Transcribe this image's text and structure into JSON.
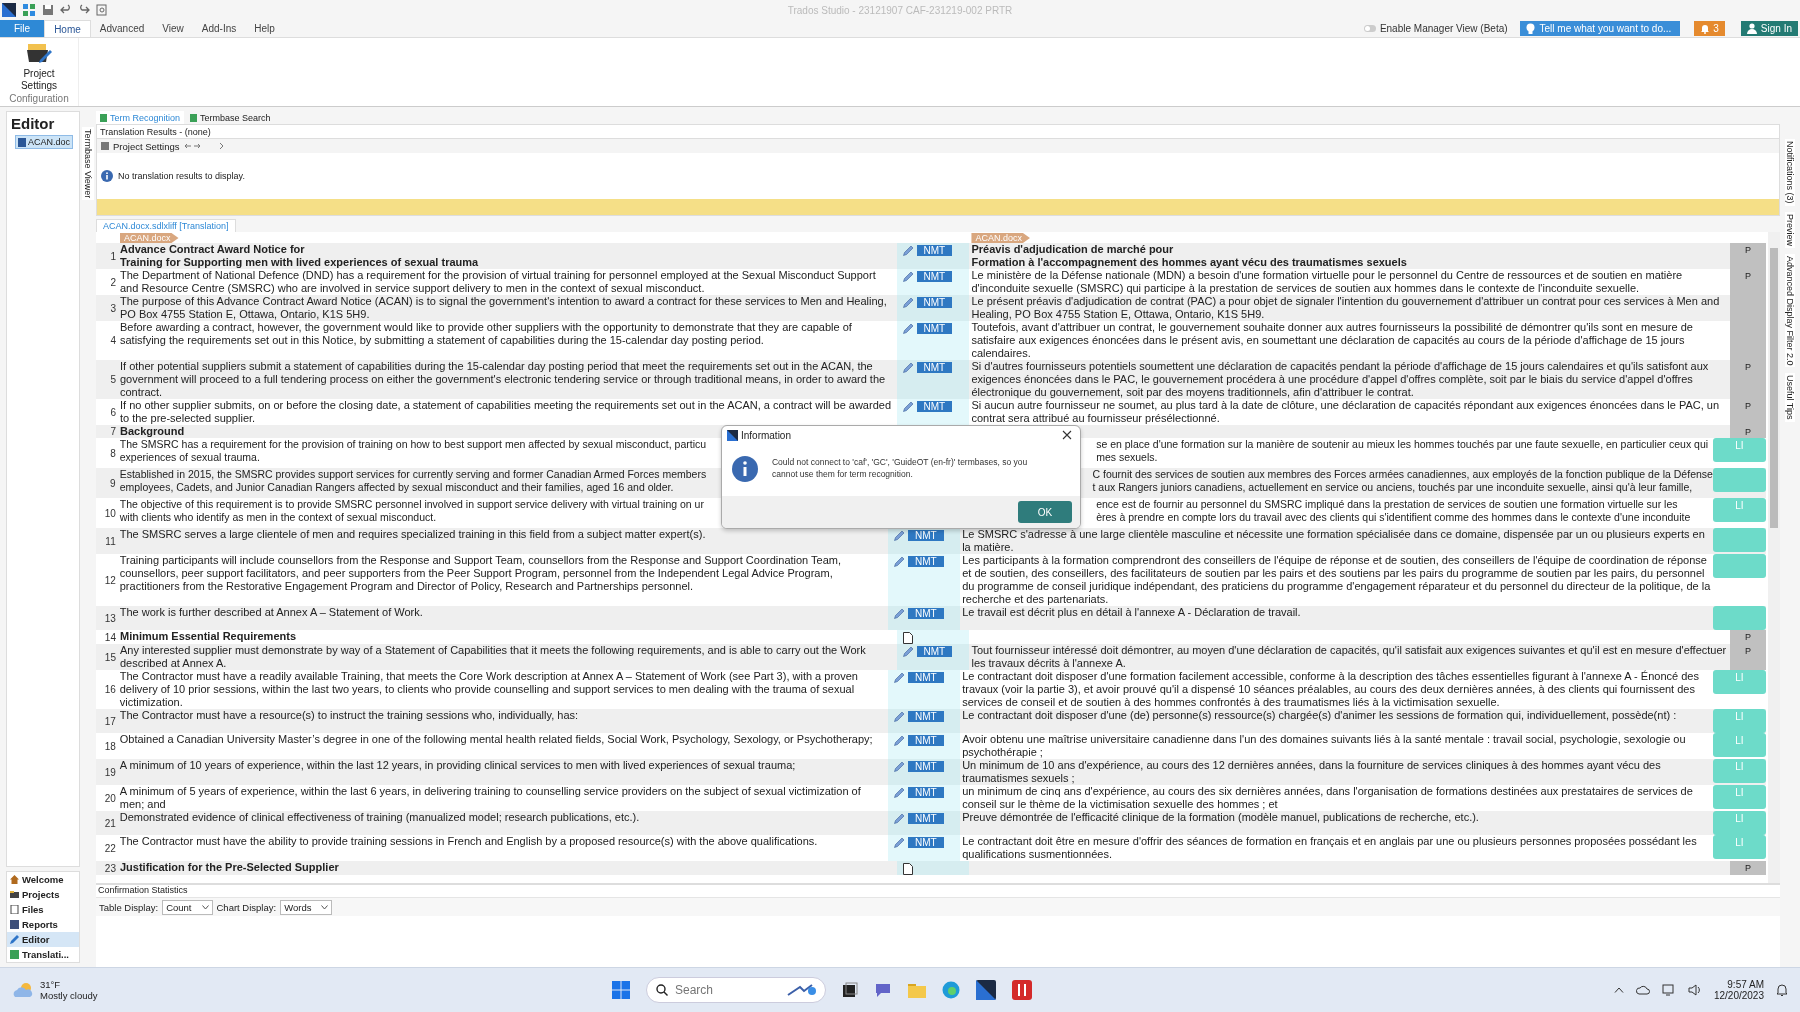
{
  "window": {
    "title": "Trados Studio - 23121907 CAF-231219-002 PRTR"
  },
  "ribbon_tabs": [
    {
      "label": "File",
      "kind": "file",
      "selected": false
    },
    {
      "label": "Home",
      "kind": "tab",
      "selected": true
    },
    {
      "label": "Advanced",
      "kind": "tab",
      "selected": false
    },
    {
      "label": "View",
      "kind": "tab",
      "selected": false
    },
    {
      "label": "Add-Ins",
      "kind": "tab",
      "selected": false
    },
    {
      "label": "Help",
      "kind": "tab",
      "selected": false
    }
  ],
  "manager_view": {
    "label": "Enable Manager View (Beta)",
    "on": false
  },
  "tell_me": "Tell me what you want to do...",
  "notifications_count": "3",
  "sign_in": "Sign In",
  "ribbon_group": {
    "button": "Project Settings",
    "label": "Configuration"
  },
  "navigation": {
    "title": "Editor",
    "files": [
      {
        "name": "ACAN.doc",
        "selected": true
      }
    ],
    "views": [
      {
        "label": "Welcome",
        "selected": false
      },
      {
        "label": "Projects",
        "selected": false
      },
      {
        "label": "Files",
        "selected": false
      },
      {
        "label": "Reports",
        "selected": false
      },
      {
        "label": "Editor",
        "selected": true
      },
      {
        "label": "Translati...",
        "selected": false
      }
    ]
  },
  "side_tab_left": "Termbase Viewer",
  "term_panel": {
    "tabs": [
      {
        "label": "Term Recognition",
        "selected": true
      },
      {
        "label": "Termbase Search",
        "selected": false
      }
    ],
    "title": "Translation Results - (none)",
    "toolbar_label": "Project Settings",
    "message": "No translation results to display."
  },
  "editor": {
    "document_tab": "ACAN.docx.sdlxliff [Translation]",
    "source_file_tag": "ACAN.docx",
    "target_file_tag": "ACAN.docx",
    "rows": [
      {
        "number": "1",
        "heading": true,
        "kind": "nmt",
        "origin": "NMT",
        "status": "P",
        "confirmed": false,
        "source": "Advance Contract Award Notice for\nTraining for Supporting men with lived experiences of sexual trauma",
        "target": "Préavis d'adjudication de marché pour\nFormation à l'accompagnement des hommes ayant vécu des traumatismes sexuels"
      },
      {
        "number": "2",
        "heading": false,
        "kind": "nmt",
        "origin": "NMT",
        "status": "P",
        "confirmed": false,
        "source": "The Department of National Defence (DND) has a requirement for the provision of virtual training for personnel employed at the Sexual Misconduct Support and Resource Centre (SMSRC) who are involved in service support delivery to men in the context of sexual misconduct.",
        "target": "Le ministère de la Défense nationale (MDN) a besoin d'une formation virtuelle pour le personnel du Centre de ressources et de soutien en matière d'inconduite sexuelle (SMSRC) qui participe à la prestation de services de soutien aux hommes dans le contexte de l'inconduite sexuelle."
      },
      {
        "number": "3",
        "heading": false,
        "kind": "nmt",
        "origin": "NMT",
        "confirmed": false,
        "source": "The purpose of this Advance Contract Award Notice (ACAN) is to signal the government's intention to award a contract for these services to Men and Healing, PO Box 4755 Station E, Ottawa, Ontario, K1S 5H9.",
        "target": "Le présent préavis d'adjudication de contrat (PAC) a pour objet de signaler l'intention du gouvernement d'attribuer un contrat pour ces services à Men and Healing, PO Box 4755 Station E, Ottawa, Ontario, K1S 5H9."
      },
      {
        "number": "4",
        "heading": false,
        "kind": "nmt",
        "origin": "NMT",
        "confirmed": false,
        "source": "Before awarding a contract, however, the government would like to provide other suppliers with the opportunity to demonstrate that they are capable of satisfying the requirements set out in this Notice, by submitting a statement of capabilities during the 15-calendar day posting period.",
        "target": "Toutefois, avant d'attribuer un contrat, le gouvernement souhaite donner aux autres fournisseurs la possibilité de démontrer qu'ils sont en mesure de satisfaire aux exigences énoncées dans le présent avis, en soumettant une déclaration de capacités au cours de la période d'affichage de 15 jours calendaires."
      },
      {
        "number": "5",
        "heading": false,
        "kind": "nmt",
        "origin": "NMT",
        "status": "P",
        "confirmed": false,
        "source": "If other potential suppliers submit a statement of capabilities during the 15-calendar day posting period that meet the requirements set out in the ACAN, the government will proceed to a full tendering process on either the government's electronic tendering service or through traditional means, in order to award the contract.",
        "target": "Si d'autres fournisseurs potentiels soumettent une déclaration de capacités pendant la période d'affichage de 15 jours calendaires et qu'ils satisfont aux exigences énoncées dans le PAC, le gouvernement procédera à une procédure d'appel d'offres complète, soit par le biais du service d'appel d'offres électronique du gouvernement, soit par des moyens traditionnels, afin d'attribuer le contrat."
      },
      {
        "number": "6",
        "heading": false,
        "kind": "nmt",
        "origin": "NMT",
        "status": "P",
        "confirmed": false,
        "source": "If no other supplier submits, on or before the closing date, a statement of capabilities meeting the requirements set out in the ACAN, a contract will be awarded to the pre-selected supplier.",
        "target": "Si aucun autre fournisseur ne soumet, au plus tard à la date de clôture, une déclaration de capacités répondant aux exigences énoncées dans le PAC, un contrat sera attribué au fournisseur présélectionné."
      },
      {
        "number": "7",
        "heading": true,
        "kind": "covered",
        "status": "P",
        "confirmed": false,
        "source": "Background"
      },
      {
        "number": "8",
        "heading": false,
        "kind": "covered",
        "status": "LI",
        "confirmed": true,
        "source": [
          "The SMSRC has a requirement for the provision of training on how to best support men affected by sexual misconduct, particu",
          "experiences of sexual trauma."
        ],
        "target": [
          "se en place d'une formation sur la manière de soutenir au mieux les hommes touchés par une faute sexuelle, en particulier ceux qui",
          "mes sexuels."
        ]
      },
      {
        "number": "9",
        "heading": false,
        "kind": "covered",
        "confirmed": true,
        "source": [
          "Established in 2015, the SMSRC provides support services for currently serving and former Canadian Armed Forces members",
          "employees, Cadets, and Junior Canadian Rangers affected by sexual misconduct and their families, aged 16 and older."
        ],
        "target": [
          "C fournit des services de soutien aux membres des Forces armées canadiennes, aux employés de la fonction publique de la Défense",
          "t aux Rangers juniors canadiens, actuellement en service ou anciens, touchés par une inconduite sexuelle, ainsi qu'à leur famille,"
        ]
      },
      {
        "number": "10",
        "heading": false,
        "kind": "covered",
        "status": "LI",
        "confirmed": true,
        "source": [
          "The objective of this requirement is to provide SMSRC personnel involved in support service delivery with virtual training on ur",
          "with clients who identify as men in the context of sexual misconduct."
        ],
        "target": [
          "ence est de fournir au personnel du SMSRC impliqué dans la prestation de services de soutien une formation virtuelle sur les",
          "ères à prendre en compte lors du travail avec des clients qui s'identifient comme des hommes dans le contexte d'une inconduite"
        ]
      },
      {
        "number": "11",
        "heading": false,
        "kind": "nmt",
        "origin": "NMT",
        "confirmed": true,
        "source": "The SMSRC serves a large clientele of men and requires specialized training in this field from a subject matter expert(s).",
        "target": "Le SMSRC s'adresse à une large clientèle masculine et nécessite une formation spécialisée dans ce domaine, dispensée par un ou plusieurs experts en la matière."
      },
      {
        "number": "12",
        "heading": false,
        "kind": "nmt",
        "origin": "NMT",
        "confirmed": true,
        "source": "Training participants will include counsellors from the Response and Support Team, counsellors from the Response and Support Coordination Team, counsellors, peer support facilitators, and peer supporters from the Peer Support Program, personnel from the Independent Legal Advice Program, practitioners from the Restorative Engagement Program and Director of Policy, Research and Partnerships personnel.",
        "target": "Les participants à la formation comprendront des conseillers de l'équipe de réponse et de soutien, des conseillers de l'équipe de coordination de réponse et de soutien, des conseillers, des facilitateurs de soutien par les pairs et des soutiens par les pairs du programme de soutien par les pairs, du personnel du programme de conseil juridique indépendant, des praticiens du programme d'engagement réparateur et du personnel du directeur de la politique, de la recherche et des partenariats."
      },
      {
        "number": "13",
        "heading": false,
        "kind": "nmt",
        "origin": "NMT",
        "confirmed": true,
        "source": "The work is further described at Annex A – Statement of Work.",
        "target": "Le travail est décrit plus en détail à l'annexe A - Déclaration de travail."
      },
      {
        "number": "14",
        "heading": true,
        "kind": "blank",
        "status": "P",
        "confirmed": false,
        "source": "Minimum Essential Requirements"
      },
      {
        "number": "15",
        "heading": false,
        "kind": "nmt",
        "origin": "NMT",
        "status": "P",
        "confirmed": false,
        "source": "Any interested supplier must demonstrate by way of a Statement of Capabilities that it meets the following requirements, and is able to carry out the Work described at Annex A.",
        "target": "Tout fournisseur intéressé doit démontrer, au moyen d'une déclaration de capacités, qu'il satisfait aux exigences suivantes et qu'il est en mesure d'effectuer les travaux décrits à l'annexe A."
      },
      {
        "number": "16",
        "heading": false,
        "kind": "nmt",
        "origin": "NMT",
        "status": "LI",
        "confirmed": true,
        "source": "The Contractor must have a readily available Training, that meets the Core Work description at Annex A – Statement of Work (see Part 3), with a proven delivery of 10 prior sessions, within the last two years, to clients who provide counselling and support services to men dealing with the trauma of sexual victimization.",
        "target": "Le contractant doit disposer d'une formation facilement accessible, conforme à la description des tâches essentielles figurant à l'annexe A - Énoncé des travaux (voir la partie 3), et avoir prouvé qu'il a dispensé 10 séances préalables, au cours des deux dernières années, à des clients qui fournissent des services de conseil et de soutien à des hommes confrontés à des traumatismes liés à la victimisation sexuelle."
      },
      {
        "number": "17",
        "heading": false,
        "kind": "nmt",
        "origin": "NMT",
        "status": "LI",
        "confirmed": true,
        "source": "The Contractor must have a resource(s) to instruct the training sessions who, individually, has:",
        "target": "Le contractant doit disposer d'une (de) personne(s) ressource(s) chargée(s) d'animer les sessions de formation qui, individuellement, possède(nt) :"
      },
      {
        "number": "18",
        "heading": false,
        "kind": "nmt",
        "origin": "NMT",
        "status": "LI",
        "confirmed": true,
        "source": "Obtained a Canadian University Master’s degree in one of the following mental health related fields, Social Work, Psychology, Sexology, or Psychotherapy;",
        "target": "Avoir obtenu une maîtrise universitaire canadienne dans l'un des domaines suivants liés à la santé mentale : travail social, psychologie, sexologie ou psychothérapie ;"
      },
      {
        "number": "19",
        "heading": false,
        "kind": "nmt",
        "origin": "NMT",
        "status": "LI",
        "confirmed": true,
        "source": "A minimum of 10 years of experience, within the last 12 years, in providing clinical services to men with lived experiences of sexual trauma;",
        "target": "Un minimum de 10 ans d'expérience, au cours des 12 dernières années, dans la fourniture de services cliniques à des hommes ayant vécu des traumatismes sexuels ;"
      },
      {
        "number": "20",
        "heading": false,
        "kind": "nmt",
        "origin": "NMT",
        "status": "LI",
        "confirmed": true,
        "source": "A minimum of 5 years of experience, within the last 6 years, in delivering training to counselling service providers on the subject of sexual victimization of men; and",
        "target": "un minimum de cinq ans d'expérience, au cours des six dernières années, dans l'organisation de formations destinées aux prestataires de services de conseil sur le thème de la victimisation sexuelle des hommes ; et"
      },
      {
        "number": "21",
        "heading": false,
        "kind": "nmt",
        "origin": "NMT",
        "status": "LI",
        "confirmed": true,
        "source": "Demonstrated evidence of clinical effectiveness of training (manualized model; research publications, etc.).",
        "target": "Preuve démontrée de l'efficacité clinique de la formation (modèle manuel, publications de recherche, etc.)."
      },
      {
        "number": "22",
        "heading": false,
        "kind": "nmt",
        "origin": "NMT",
        "status": "LI",
        "confirmed": true,
        "source": "The Contractor must have the ability to provide training sessions in French and English by a proposed resource(s) with the above qualifications.",
        "target": "Le contractant doit être en mesure d'offrir des séances de formation en français et en anglais par une ou plusieurs personnes proposées possédant les qualifications susmentionnées."
      },
      {
        "number": "23",
        "heading": true,
        "kind": "blank",
        "status": "P",
        "confirmed": false,
        "source": "Justification for the Pre-Selected Supplier"
      }
    ]
  },
  "right_tabs": [
    "Notifications (3)",
    "Preview",
    "Advanced Display Filter 2.0",
    "Useful Tips"
  ],
  "statistics": {
    "title": "Confirmation Statistics",
    "table_display_label": "Table Display:",
    "table_display": "Count",
    "chart_display_label": "Chart Display:",
    "chart_display": "Words"
  },
  "dialog": {
    "title": "Information",
    "message": "Could not connect to 'caf', 'GC', 'GuideOT (en-fr)' termbases, so you cannot use them for term recognition.",
    "button": "OK"
  },
  "taskbar": {
    "weather_temp": "31°F",
    "weather_text": "Mostly cloudy",
    "search_placeholder": "Search",
    "time": "9:57 AM",
    "date": "12/20/2023"
  }
}
